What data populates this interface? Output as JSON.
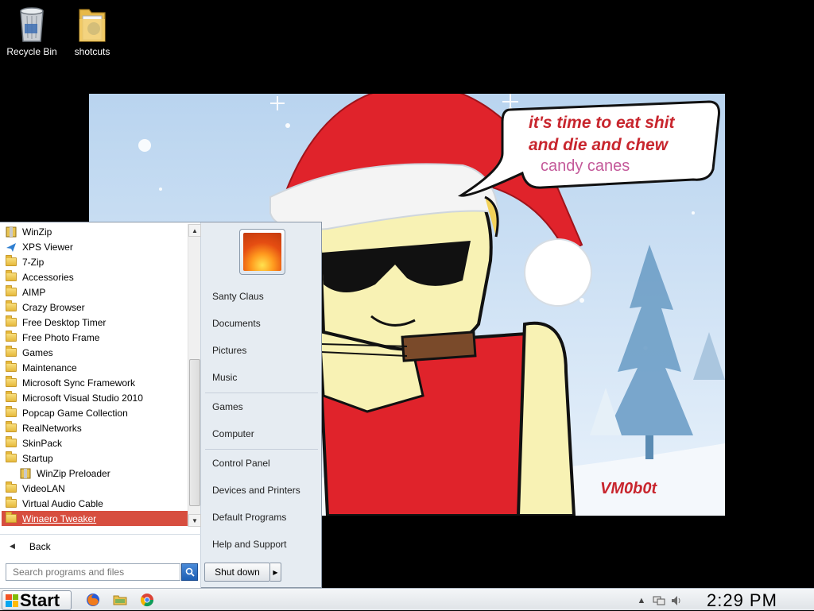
{
  "desktop": {
    "icons": [
      {
        "label": "Recycle Bin",
        "icon": "recycle-bin-icon"
      },
      {
        "label": "shotcuts",
        "icon": "folder-icon"
      }
    ]
  },
  "wallpaper": {
    "bubble_line1": "it's time to eat shit",
    "bubble_line2": "and die and chew",
    "bubble_line3": "candy canes",
    "signature": "VM0b0t",
    "text_color": "#c8262e"
  },
  "start_menu": {
    "programs": [
      {
        "label": "WinZip",
        "icon": "winzip-icon"
      },
      {
        "label": "XPS Viewer",
        "icon": "xps-viewer-icon"
      },
      {
        "label": "7-Zip",
        "icon": "folder-icon"
      },
      {
        "label": "Accessories",
        "icon": "folder-icon"
      },
      {
        "label": "AIMP",
        "icon": "folder-icon"
      },
      {
        "label": "Crazy Browser",
        "icon": "folder-icon"
      },
      {
        "label": "Free Desktop Timer",
        "icon": "folder-icon"
      },
      {
        "label": "Free Photo Frame",
        "icon": "folder-icon"
      },
      {
        "label": "Games",
        "icon": "folder-icon"
      },
      {
        "label": "Maintenance",
        "icon": "folder-icon"
      },
      {
        "label": "Microsoft Sync Framework",
        "icon": "folder-icon"
      },
      {
        "label": "Microsoft Visual Studio 2010",
        "icon": "folder-icon"
      },
      {
        "label": "Popcap Game Collection",
        "icon": "folder-icon"
      },
      {
        "label": "RealNetworks",
        "icon": "folder-icon"
      },
      {
        "label": "SkinPack",
        "icon": "folder-icon"
      },
      {
        "label": "Startup",
        "icon": "folder-icon"
      },
      {
        "label": "WinZip Preloader",
        "icon": "winzip-icon"
      },
      {
        "label": "VideoLAN",
        "icon": "folder-icon"
      },
      {
        "label": "Virtual Audio Cable",
        "icon": "folder-icon"
      },
      {
        "label": "Winaero Tweaker",
        "icon": "folder-icon"
      }
    ],
    "selected_program": "Winaero Tweaker",
    "selected_color": "#d74e3f",
    "back_label": "Back",
    "search_placeholder": "Search programs and files",
    "right_items": [
      {
        "label": "Santy Claus"
      },
      {
        "label": "Documents"
      },
      {
        "label": "Pictures"
      },
      {
        "label": "Music"
      },
      {
        "label": "Games"
      },
      {
        "label": "Computer"
      },
      {
        "label": "Control Panel"
      },
      {
        "label": "Devices and Printers"
      },
      {
        "label": "Default Programs"
      },
      {
        "label": "Help and Support"
      }
    ],
    "shutdown_label": "Shut down"
  },
  "taskbar": {
    "start_label": "Start",
    "pinned": [
      "firefox-icon",
      "file-explorer-icon",
      "chrome-icon"
    ],
    "tray_icons": [
      "show-hidden-icons-chevron",
      "network-icon",
      "volume-icon"
    ],
    "clock": "2:29 PM"
  }
}
